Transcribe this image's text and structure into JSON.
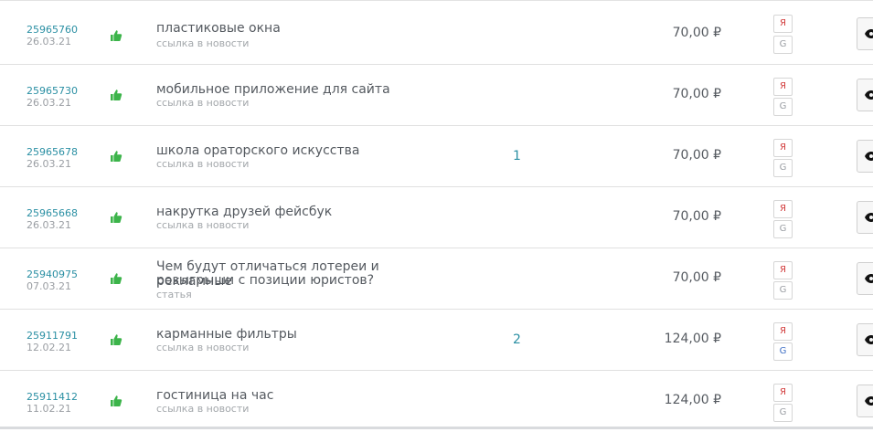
{
  "rows": [
    {
      "id": "25965760",
      "date": "26.03.21",
      "title_line1": "пластиковые окна",
      "title_line2": "",
      "type": "ссылка в новости",
      "count": "",
      "price": "70,00 ₽",
      "yandex": "Я",
      "google": "G",
      "google_active": false
    },
    {
      "id": "25965730",
      "date": "26.03.21",
      "title_line1": "мобильное приложение для сайта",
      "title_line2": "",
      "type": "ссылка в новости",
      "count": "",
      "price": "70,00 ₽",
      "yandex": "Я",
      "google": "G",
      "google_active": false
    },
    {
      "id": "25965678",
      "date": "26.03.21",
      "title_line1": "школа ораторского искусства",
      "title_line2": "",
      "type": "ссылка в новости",
      "count": "1",
      "price": "70,00 ₽",
      "yandex": "Я",
      "google": "G",
      "google_active": false
    },
    {
      "id": "25965668",
      "date": "26.03.21",
      "title_line1": "накрутка друзей фейсбук",
      "title_line2": "",
      "type": "ссылка в новости",
      "count": "",
      "price": "70,00 ₽",
      "yandex": "Я",
      "google": "G",
      "google_active": false
    },
    {
      "id": "25940975",
      "date": "07.03.21",
      "title_line1": "Чем будут отличаться лотереи и рекламные",
      "title_line2": "розыгрыши с позиции юристов?",
      "type": "статья",
      "count": "",
      "price": "70,00 ₽",
      "yandex": "Я",
      "google": "G",
      "google_active": false
    },
    {
      "id": "25911791",
      "date": "12.02.21",
      "title_line1": "карманные фильтры",
      "title_line2": "",
      "type": "ссылка в новости",
      "count": "2",
      "price": "124,00 ₽",
      "yandex": "Я",
      "google": "G",
      "google_active": true
    },
    {
      "id": "25911412",
      "date": "11.02.21",
      "title_line1": "гостиница на час",
      "title_line2": "",
      "type": "ссылка в новости",
      "count": "",
      "price": "124,00 ₽",
      "yandex": "Я",
      "google": "G",
      "google_active": false
    }
  ],
  "icons": {
    "status": "thumbs-up-icon",
    "view": "eye-icon"
  },
  "colors": {
    "accent": "#2a8fa3",
    "thumb": "#3cb44a",
    "yandex": "#d23c3c",
    "google_active": "#3e6fc5"
  }
}
